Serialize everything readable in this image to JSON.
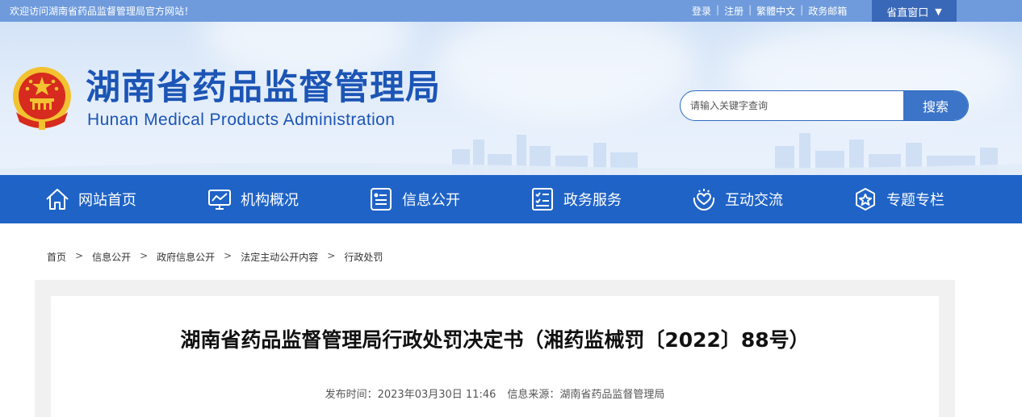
{
  "topbar": {
    "welcome": "欢迎访问湖南省药品监督管理局官方网站！",
    "links": [
      "登录",
      "注册",
      "繁體中文",
      "政务邮箱"
    ],
    "province_window": "省直窗口",
    "province_window_icon": "triangle-down-icon"
  },
  "header": {
    "emblem_icon": "national-emblem-icon",
    "title": "湖南省药品监督管理局",
    "subtitle": "Hunan Medical Products Administration",
    "search": {
      "placeholder": "请输入关键字查询",
      "value": "",
      "button": "搜索"
    }
  },
  "nav": {
    "items": [
      {
        "label": "网站首页",
        "icon": "home-icon"
      },
      {
        "label": "机构概况",
        "icon": "monitor-chart-icon"
      },
      {
        "label": "信息公开",
        "icon": "document-list-icon"
      },
      {
        "label": "政务服务",
        "icon": "checklist-icon"
      },
      {
        "label": "互动交流",
        "icon": "heart-hands-icon"
      },
      {
        "label": "专题专栏",
        "icon": "star-badge-icon"
      }
    ]
  },
  "breadcrumb": {
    "separator": ">",
    "items": [
      "首页",
      "信息公开",
      "政府信息公开",
      "法定主动公开内容",
      "行政处罚"
    ]
  },
  "article": {
    "title": "湖南省药品监督管理局行政处罚决定书（湘药监械罚〔2022〕88号）",
    "publish_label": "发布时间：",
    "publish_time": "2023年03月30日 11:46",
    "source_label": "信息来源：",
    "source": "湖南省药品监督管理局"
  },
  "colors": {
    "topbar": "#6f9bdc",
    "nav": "#1f63c7",
    "brand_text": "#1c55b5",
    "search_button": "#3c74c8",
    "province_button": "#3a68b8"
  }
}
